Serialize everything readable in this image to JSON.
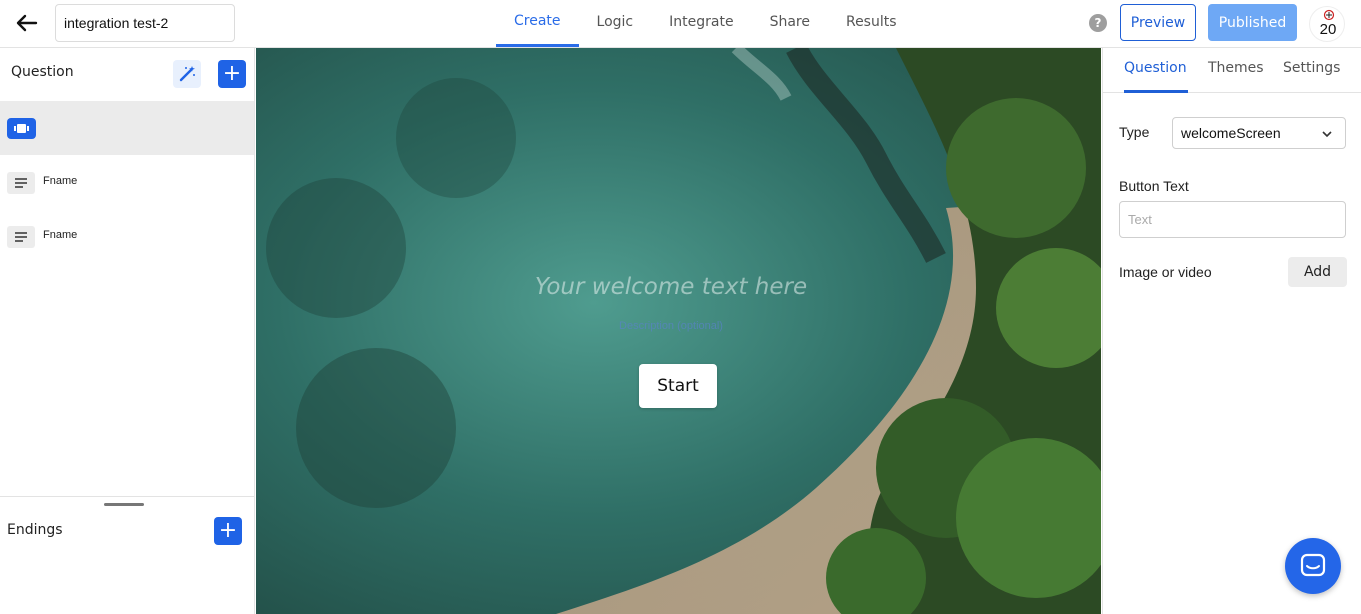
{
  "header": {
    "form_name": "integration test-2",
    "tabs": [
      {
        "label": "Create"
      },
      {
        "label": "Logic"
      },
      {
        "label": "Integrate"
      },
      {
        "label": "Share"
      },
      {
        "label": "Results"
      }
    ],
    "help_label": "?",
    "preview_label": "Preview",
    "published_label": "Published",
    "avatar_text": "20"
  },
  "left_panel": {
    "title": "Question",
    "items": [
      {
        "label": "",
        "icon": "welcome-screen-icon"
      },
      {
        "label": "Fname",
        "icon": "short-text-icon"
      },
      {
        "label": "Fname",
        "icon": "short-text-icon"
      }
    ],
    "endings_title": "Endings",
    "add_symbol": "+"
  },
  "canvas": {
    "welcome_text": "Your welcome text here",
    "description": "Description (optional)",
    "start_label": "Start"
  },
  "right_panel": {
    "tabs": [
      {
        "label": "Question"
      },
      {
        "label": "Themes"
      },
      {
        "label": "Settings"
      }
    ],
    "type_label": "Type",
    "type_value": "welcomeScreen",
    "button_text_label": "Button Text",
    "button_text_placeholder": "Text",
    "image_label": "Image or video",
    "add_label": "Add"
  },
  "colors": {
    "accent": "#1f63e6",
    "published": "#6ea8f5"
  }
}
